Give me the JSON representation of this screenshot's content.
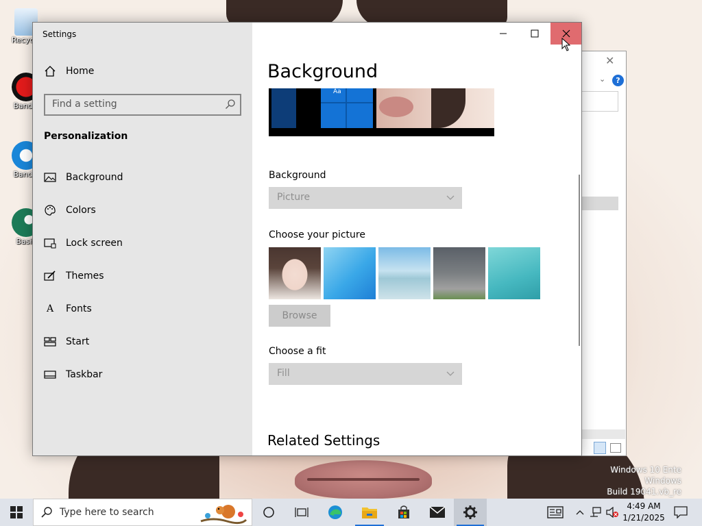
{
  "desktop": {
    "icons": [
      {
        "label": "Recycle",
        "icon": "recycle-bin-icon"
      },
      {
        "label": "Bandic",
        "icon": "bandicam-icon"
      },
      {
        "label": "Bandic",
        "icon": "bandicut-icon"
      },
      {
        "label": "Basili",
        "icon": "basilisk-icon"
      }
    ],
    "watermark": [
      "Windows 10 Ente",
      "Windows",
      "Build 19041.vb_re"
    ]
  },
  "settings": {
    "window_title": "Settings",
    "nav": {
      "home": "Home",
      "search_placeholder": "Find a setting",
      "section": "Personalization",
      "items": [
        {
          "label": "Background",
          "icon": "picture-icon"
        },
        {
          "label": "Colors",
          "icon": "palette-icon"
        },
        {
          "label": "Lock screen",
          "icon": "lock-screen-icon"
        },
        {
          "label": "Themes",
          "icon": "brush-icon"
        },
        {
          "label": "Fonts",
          "icon": "font-icon"
        },
        {
          "label": "Start",
          "icon": "start-icon"
        },
        {
          "label": "Taskbar",
          "icon": "taskbar-icon"
        }
      ]
    },
    "content": {
      "title": "Background",
      "preview_tile_text": "Aa",
      "background_label": "Background",
      "background_value": "Picture",
      "picture_label": "Choose your picture",
      "browse_label": "Browse",
      "fit_label": "Choose a fit",
      "fit_value": "Fill",
      "related_title": "Related Settings"
    },
    "colors": {
      "close_hover": "#e06b6f",
      "nav_bg": "#e6e6e6",
      "accent": "#1473d6"
    }
  },
  "taskbar": {
    "search_placeholder": "Type here to search",
    "time": "4:49 AM",
    "date": "1/21/2025",
    "apps": [
      "cortana-icon",
      "task-view-icon",
      "edge-icon",
      "file-explorer-icon",
      "store-icon",
      "mail-icon",
      "settings-icon"
    ]
  }
}
